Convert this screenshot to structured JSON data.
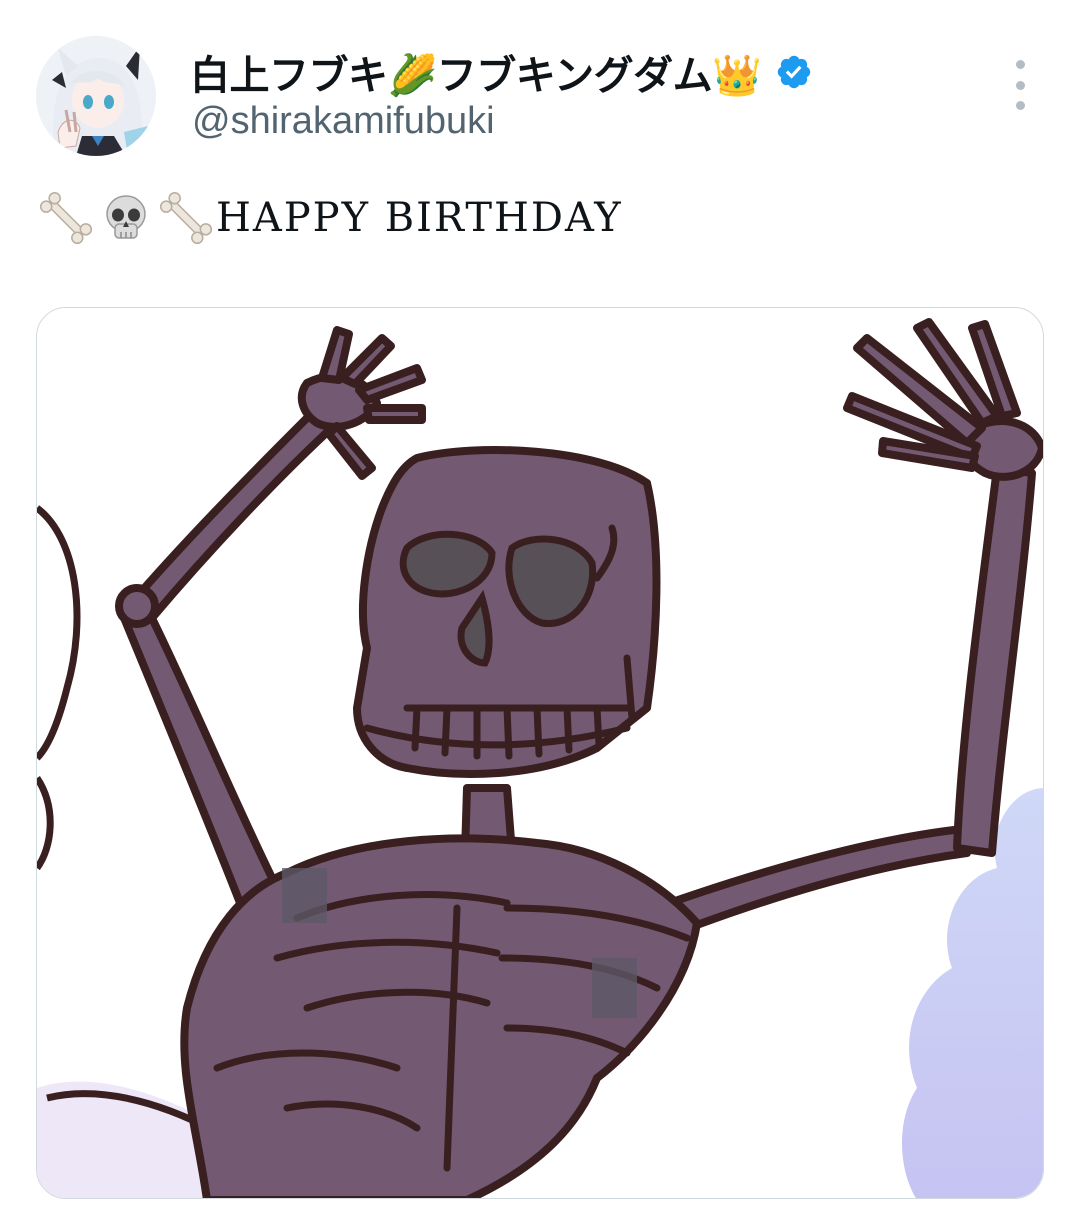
{
  "post": {
    "author": {
      "display_name": "白上フブキ🌽フブキングダム👑",
      "handle": "@shirakamifubuki",
      "verified_badge_icon": "verified-badge-icon",
      "avatar": "avatar-image"
    },
    "menu_icon": "more-options-icon",
    "text": {
      "emojis": [
        "bone-icon",
        "skull-icon",
        "bone-icon"
      ],
      "content": "HAPPY BIRTHDAY"
    },
    "media": {
      "description_icon": "skeleton-drawing-image"
    }
  },
  "colors": {
    "name": "#0f1419",
    "handle": "#536471",
    "verified": "#1d9bf0",
    "skeleton_fill": "#735a72",
    "skeleton_stroke": "#3a1f20",
    "cloud": "#c9cbf5"
  }
}
